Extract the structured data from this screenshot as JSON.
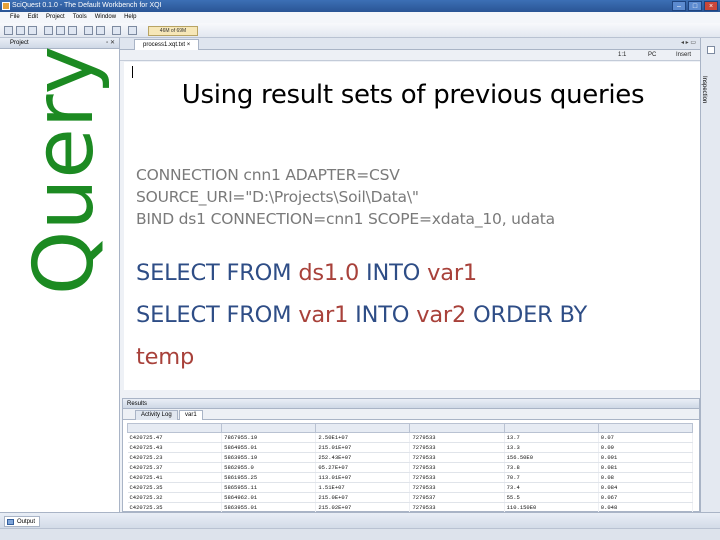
{
  "window": {
    "title": "SciQuest 0.1.0 - The Default Workbench for XQI",
    "controls": [
      "–",
      "□",
      "×"
    ]
  },
  "menu": [
    "File",
    "Edit",
    "Project",
    "Tools",
    "Window",
    "Help"
  ],
  "toolbar": {
    "memory": "46M of 69M"
  },
  "project_panel": {
    "title": "Project",
    "overlay_label": "Query"
  },
  "editor": {
    "tab_label": "process1.xqt.txt",
    "status": {
      "position": "1:1",
      "encoding": "PC",
      "mode": "Insert"
    }
  },
  "slide": {
    "title": "Using result sets of previous queries",
    "connection_line1": "CONNECTION cnn1 ADAPTER=CSV",
    "connection_line2": "SOURCE_URI=\"D:\\Projects\\Soil\\Data\\\"",
    "bind_line": "BIND ds1 CONNECTION=cnn1 SCOPE=xdata_10, udata",
    "q1": {
      "a": "SELECT FROM ",
      "b": "ds1.0",
      "c": " INTO ",
      "d": "var1"
    },
    "q2": {
      "a": "SELECT FROM ",
      "b": "var1",
      "c": " INTO ",
      "d": "var2",
      "e": " ORDER BY",
      "f": "temp"
    }
  },
  "results": {
    "title": "Results",
    "tabs": [
      "Activity Log",
      "var1"
    ],
    "rows": [
      [
        "C420725.47",
        "7867955.19",
        "2.50E1+07",
        "7279533",
        "13.7",
        "0.07"
      ],
      [
        "C420725.43",
        "5864955.01",
        "215.01E+07",
        "7279533",
        "13.3",
        "0.09"
      ],
      [
        "C420725.23",
        "5863955.19",
        "252.43E+07",
        "7279533",
        "156.50E0",
        "0.091"
      ],
      [
        "C420725.37",
        "5862955.0",
        "05.27E+07",
        "7279533",
        "73.8",
        "0.081"
      ],
      [
        "C420725.41",
        "5861955.25",
        "113.01E+07",
        "7279533",
        "70.7",
        "0.08"
      ],
      [
        "C420725.35",
        "5865955.11",
        "1.51E+07",
        "7279533",
        "73.4",
        "0.084"
      ],
      [
        "C420725.32",
        "5864962.01",
        "215.0E+07",
        "7279537",
        "55.5",
        "0.067"
      ],
      [
        "C420725.35",
        "5863955.01",
        "215.02E+07",
        "7279533",
        "110.150E0",
        "0.048"
      ]
    ]
  },
  "right_bar": {
    "label": "Inspection"
  },
  "bottom": {
    "output_label": "Output"
  }
}
